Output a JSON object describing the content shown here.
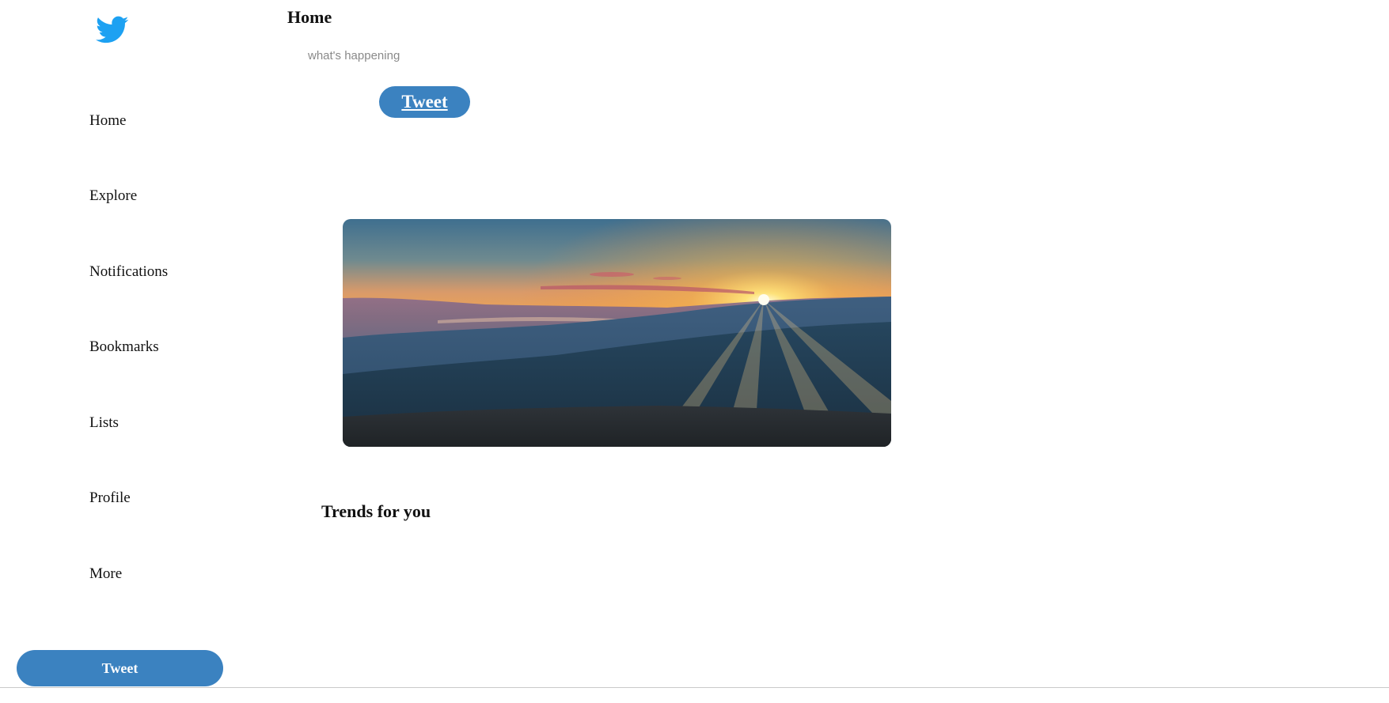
{
  "app": {
    "logo_icon": "twitter-bird-icon",
    "brand_color": "#1da1f2",
    "accent_color": "#3b82c0"
  },
  "sidebar": {
    "items": [
      {
        "label": "Home"
      },
      {
        "label": "Explore"
      },
      {
        "label": "Notifications"
      },
      {
        "label": "Bookmarks"
      },
      {
        "label": "Lists"
      },
      {
        "label": "Profile"
      },
      {
        "label": "More"
      }
    ],
    "tweet_button_label": "Tweet"
  },
  "main": {
    "title": "Home",
    "compose": {
      "placeholder": "what's happening",
      "value": "",
      "tweet_button_label": "Tweet"
    },
    "trends_title": "Trends for you"
  }
}
